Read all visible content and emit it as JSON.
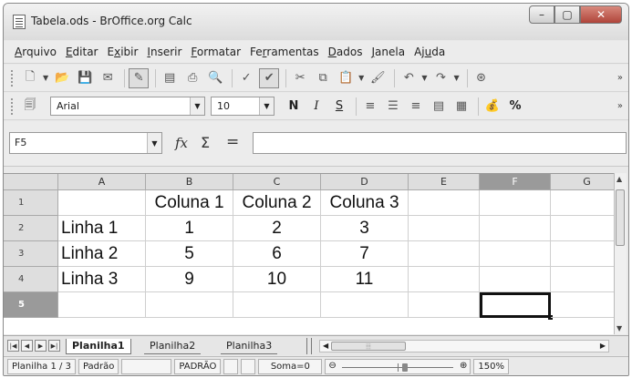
{
  "window": {
    "title": "Tabela.ods - BrOffice.org Calc",
    "buttons": {
      "minimize": "–",
      "maximize": "▢",
      "close": "✕"
    }
  },
  "menu": [
    {
      "pre": "",
      "key": "A",
      "post": "rquivo"
    },
    {
      "pre": "",
      "key": "E",
      "post": "ditar"
    },
    {
      "pre": "E",
      "key": "x",
      "post": "ibir"
    },
    {
      "pre": "",
      "key": "I",
      "post": "nserir"
    },
    {
      "pre": "",
      "key": "F",
      "post": "ormatar"
    },
    {
      "pre": "Fe",
      "key": "r",
      "post": "ramentas"
    },
    {
      "pre": "",
      "key": "D",
      "post": "ados"
    },
    {
      "pre": "",
      "key": "J",
      "post": "anela"
    },
    {
      "pre": "Aj",
      "key": "u",
      "post": "da"
    }
  ],
  "formatting": {
    "font_name": "Arial",
    "font_size": "10",
    "bold": "N",
    "italic": "I",
    "underline": "S",
    "percent": "%"
  },
  "formula_bar": {
    "name_box": "F5",
    "fx": "fx",
    "sum": "Σ",
    "equals": "=",
    "content": ""
  },
  "sheet": {
    "columns": [
      "A",
      "B",
      "C",
      "D",
      "E",
      "F",
      "G"
    ],
    "active_column": "F",
    "rows": [
      "1",
      "2",
      "3",
      "4",
      "5"
    ],
    "active_row": "5",
    "selected_cell": "F5",
    "cells": {
      "r1": [
        "",
        "Coluna 1",
        "Coluna 2",
        "Coluna 3",
        "",
        "",
        ""
      ],
      "r2": [
        "Linha 1",
        "1",
        "2",
        "3",
        "",
        "",
        ""
      ],
      "r3": [
        "Linha 2",
        "5",
        "6",
        "7",
        "",
        "",
        ""
      ],
      "r4": [
        "Linha 3",
        "9",
        "10",
        "11",
        "",
        "",
        ""
      ],
      "r5": [
        "",
        "",
        "",
        "",
        "",
        "",
        ""
      ]
    }
  },
  "tabs": {
    "sheets": [
      "Planilha1",
      "Planilha2",
      "Planilha3"
    ],
    "active": "Planilha1"
  },
  "status": {
    "sheet_position": "Planilha 1 / 3",
    "page_style": "Padrão",
    "mode": "PADRÃO",
    "sum": "Soma=0",
    "zoom": "150%",
    "zoom_minus": "⊖",
    "zoom_plus": "⊕"
  }
}
